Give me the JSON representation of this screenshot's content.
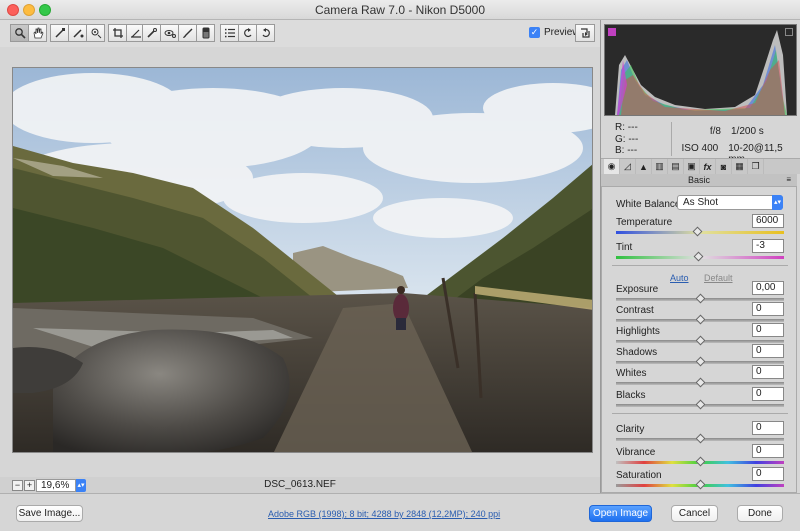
{
  "window": {
    "title": "Camera Raw 7.0  -  Nikon D5000"
  },
  "toolbar": {
    "tools": [
      "zoom-icon",
      "hand-icon",
      "white-balance-icon",
      "color-sampler-icon",
      "target-adjust-icon",
      "crop-icon",
      "straighten-icon",
      "spot-removal-icon",
      "red-eye-icon",
      "adjustment-brush-icon",
      "graduated-filter-icon",
      "preferences-icon",
      "rotate-ccw-icon",
      "rotate-cw-icon"
    ],
    "preview_label": "Preview",
    "preview_checked": "✓"
  },
  "canvas": {
    "zoom_minus": "−",
    "zoom_plus": "+",
    "zoom_value": "19,6%",
    "filename": "DSC_0613.NEF"
  },
  "readout": {
    "r": "R:   ---",
    "g": "G:   ---",
    "b": "B:   ---",
    "aperture": "f/8",
    "shutter": "1/200 s",
    "iso": "ISO 400",
    "lens": "10-20@11,5 mm"
  },
  "panel": {
    "title": "Basic",
    "menu": "≡",
    "white_balance_label": "White Balance:",
    "white_balance_value": "As Shot",
    "auto": "Auto",
    "default": "Default",
    "sliders": [
      {
        "label": "Temperature",
        "value": "6000",
        "position": 0.48
      },
      {
        "label": "Tint",
        "value": "-3",
        "position": 0.49
      },
      {
        "label": "Exposure",
        "value": "0,00",
        "position": 0.5
      },
      {
        "label": "Contrast",
        "value": "0",
        "position": 0.5
      },
      {
        "label": "Highlights",
        "value": "0",
        "position": 0.5
      },
      {
        "label": "Shadows",
        "value": "0",
        "position": 0.5
      },
      {
        "label": "Whites",
        "value": "0",
        "position": 0.5
      },
      {
        "label": "Blacks",
        "value": "0",
        "position": 0.5
      },
      {
        "label": "Clarity",
        "value": "0",
        "position": 0.5
      },
      {
        "label": "Vibrance",
        "value": "0",
        "position": 0.5
      },
      {
        "label": "Saturation",
        "value": "0",
        "position": 0.5
      }
    ]
  },
  "bottom": {
    "save_image": "Save Image...",
    "info_link": "Adobe RGB (1998); 8 bit; 4288 by 2848 (12,2MP); 240 ppi",
    "open_image": "Open Image",
    "cancel": "Cancel",
    "done": "Done"
  }
}
